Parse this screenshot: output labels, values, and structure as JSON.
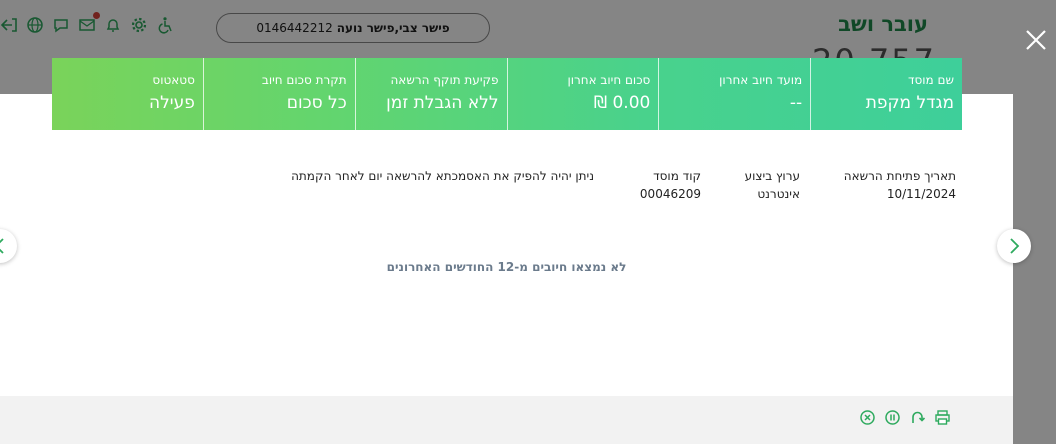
{
  "background": {
    "title": "עובר ושב",
    "number_partial": "20 757",
    "user_phone": "0146442212",
    "user_name": "פישר צבי,פישר נועה",
    "icons": [
      "logout-icon",
      "globe-icon",
      "chat-icon",
      "mail-icon",
      "bell-icon",
      "settings-icon",
      "accessibility-icon"
    ]
  },
  "header": {
    "cells": [
      {
        "label": "שם מוסד",
        "value": "מגדל מקפת"
      },
      {
        "label": "מועד חיוב אחרון",
        "value": "--"
      },
      {
        "label": "סכום חיוב אחרון",
        "value": "0.00 ₪"
      },
      {
        "label": "פקיעת תוקף הרשאה",
        "value": "ללא הגבלת זמן"
      },
      {
        "label": "תקרת סכום חיוב",
        "value": "כל סכום"
      },
      {
        "label": "סטאטוס",
        "value": "פעילה"
      }
    ]
  },
  "details": {
    "open_date_label": "תאריך פתיחת הרשאה",
    "open_date_value": "10/11/2024",
    "channel_label": "ערוץ ביצוע",
    "channel_value": "אינטרנט",
    "institution_code_label": "קוד מוסד",
    "institution_code_value": "00046209",
    "note": "ניתן יהיה להפיק את האסמכתא להרשאה יום לאחר הקמתה"
  },
  "empty_message": "לא נמצאו חיובים מ-12 החודשים האחרונים",
  "footer_icons": [
    "print-icon",
    "undo-icon",
    "pause-icon",
    "cancel-icon"
  ],
  "colors": {
    "header_gradient_start": "#3ecf9a",
    "header_gradient_end": "#7ad35a",
    "brand_green": "#1f8a4c",
    "icon_green": "#2eaa5e"
  }
}
